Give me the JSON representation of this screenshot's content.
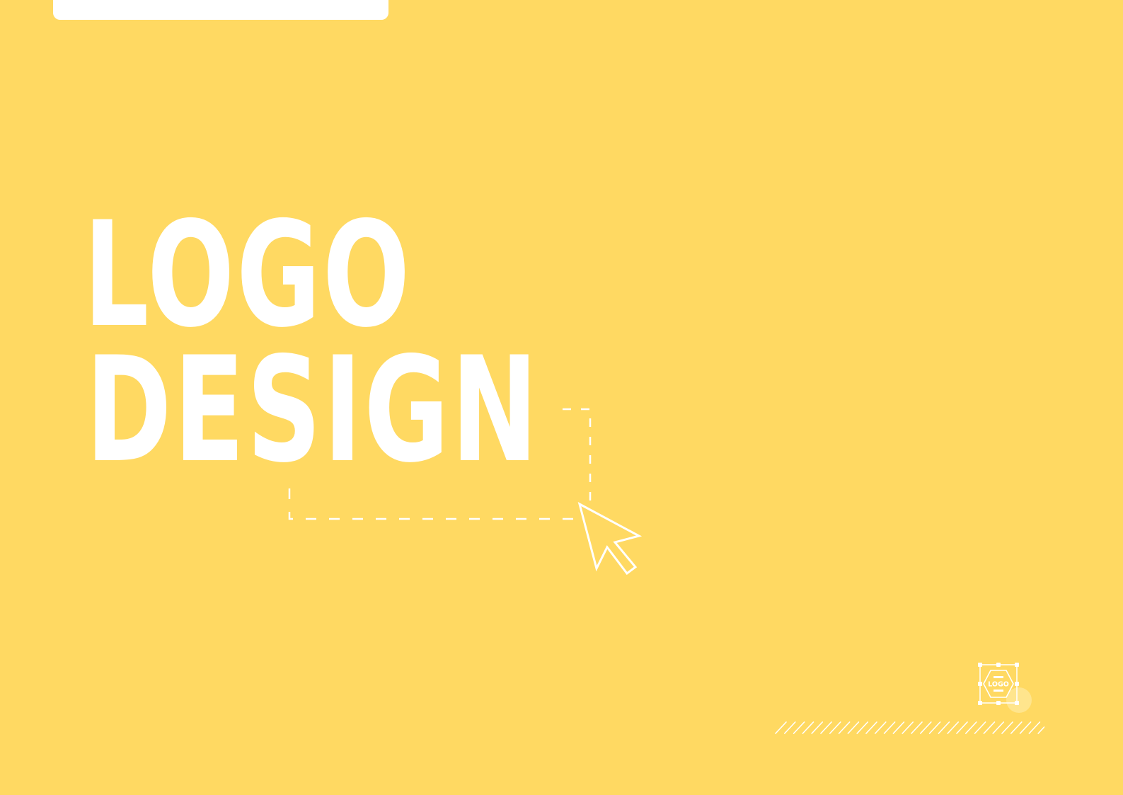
{
  "colors": {
    "background": "#FFD962",
    "foreground": "#FFFFFF",
    "accent_dot": "#FFF3C4"
  },
  "title": {
    "line1": "LOGO",
    "line2": "DESIGN"
  },
  "badge": {
    "label": "LOGO",
    "icon": "logo-badge-icon"
  },
  "decor": {
    "cursor_icon": "cursor-arrow-icon",
    "hatch_icon": "diagonal-hatch-icon"
  }
}
